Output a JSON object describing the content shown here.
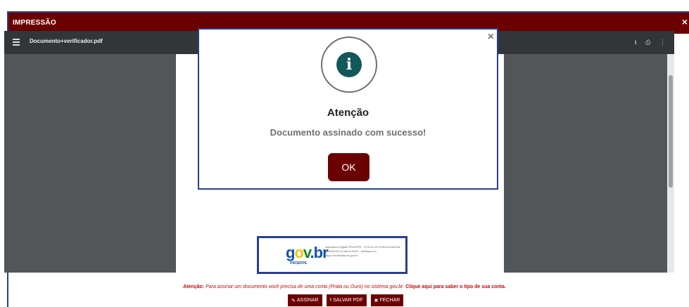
{
  "window": {
    "title": "IMPRESSÃO",
    "close_glyph": "×"
  },
  "viewer": {
    "file_name": "Documento+verificador.pdf",
    "icons": {
      "download": "⭳",
      "print": "⎙",
      "more": "⋮"
    }
  },
  "stamp": {
    "logo_g": "g",
    "logo_o": "o",
    "logo_v": "v",
    "logo_br": ".br",
    "sub": "PROEPPE",
    "text": "Assinatura Digital PROEPPE · GYSLA VICTORIA ALMEIDA · 21/05/2023 10:48:15-0300 · Verifique em https://verificador.iti.gov.br"
  },
  "notice": {
    "label": "Atenção:",
    "message": "Para assinar um documento você precisa de uma conta (Prata ou Ouro) no sistema gov.br.",
    "link": "Clique aqui para saber o tipo de sua conta."
  },
  "actions": {
    "sign_icon": "✎",
    "sign": "ASSINAR",
    "save_icon": "⭳",
    "save": "SALVAR PDF",
    "close_icon": "✖",
    "close": "FECHAR"
  },
  "modal": {
    "close_glyph": "×",
    "info_glyph": "i",
    "title": "Atenção",
    "message": "Documento assinado com sucesso!",
    "ok": "OK"
  },
  "colors": {
    "primary": "#6b0000",
    "accent_border": "#2b3f8f",
    "info": "#12575a",
    "warning_text": "#d40000"
  }
}
